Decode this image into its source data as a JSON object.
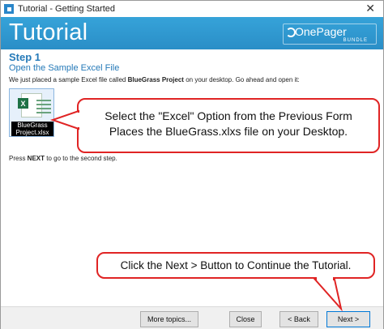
{
  "window": {
    "title": "Tutorial - Getting Started",
    "close_glyph": "✕"
  },
  "banner": {
    "title": "Tutorial",
    "logo_text": "OnePager",
    "logo_sub": "BUNDLE"
  },
  "content": {
    "step_title": "Step 1",
    "step_subtitle": "Open the Sample Excel File",
    "instruction_prefix": "We just placed a sample Excel file called ",
    "instruction_bold": "BlueGrass Project",
    "instruction_suffix": " on your desktop. Go ahead and open it:",
    "file_label": "BlueGrass Project.xlsx",
    "file_icon_letter": "X",
    "press_prefix": "Press ",
    "press_bold": "NEXT",
    "press_suffix": " to go to the second step."
  },
  "callouts": {
    "first_line1": "Select the \"Excel\" Option from the Previous Form",
    "first_line2": "Places the BlueGrass.xlxs file on your Desktop.",
    "second": "Click the Next > Button to Continue the Tutorial."
  },
  "footer": {
    "more_label": "More topics...",
    "close_label": "Close",
    "back_label": "< Back",
    "next_label": "Next >"
  },
  "colors": {
    "banner": "#2a8ec7",
    "heading": "#2479b8",
    "callout_border": "#e02424",
    "excel_green": "#1e7145"
  },
  "icons": [
    "app-icon",
    "close-icon",
    "onepager-logo-icon",
    "excel-file-icon"
  ]
}
